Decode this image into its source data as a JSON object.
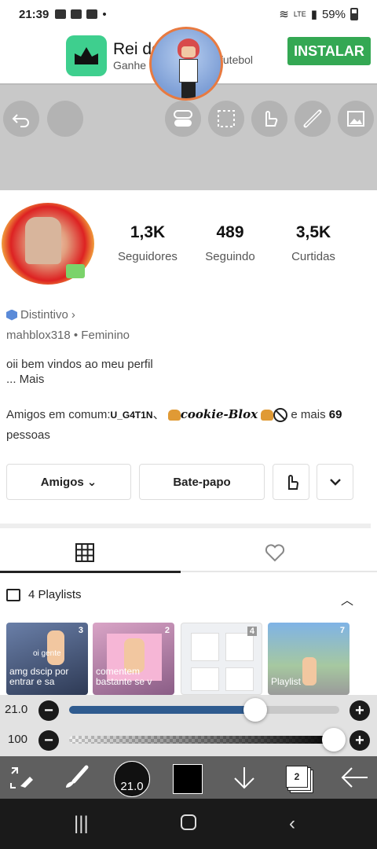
{
  "status_bar": {
    "time": "21:39",
    "network": "LTE",
    "battery": "59%"
  },
  "ad": {
    "title": "Rei do",
    "subtitle": "Ganhe",
    "subtitle_suffix": "futebol",
    "install_label": "INSTALAR"
  },
  "profile": {
    "stats": [
      {
        "value": "1,3K",
        "label": "Seguidores"
      },
      {
        "value": "489",
        "label": "Seguindo"
      },
      {
        "value": "3,5K",
        "label": "Curtidas"
      }
    ],
    "badge_label": "Distintivo",
    "handle": "mahblox318 • Feminino",
    "bio_line1": "oii bem vindos ao meu perfil",
    "bio_more": "... Mais",
    "mutual_prefix": "Amigos em comum:",
    "mutual_user1": "U_G4T1N",
    "mutual_user2": "cookie-Blox",
    "mutual_suffix": "e mais",
    "mutual_count": "69",
    "mutual_people": "pessoas",
    "friends_button": "Amigos",
    "chat_button": "Bate-papo"
  },
  "playlists": {
    "header": "4 Playlists",
    "items": [
      {
        "count": "3",
        "caption": "amg dscip por entrar e sa",
        "inner_label": "oi gente"
      },
      {
        "count": "2",
        "caption": "comentem bastante se v"
      },
      {
        "count": "4",
        "caption": ""
      },
      {
        "count": "7",
        "caption": "Playlist"
      }
    ]
  },
  "sliders": {
    "size_value": "21.0",
    "opacity_value": "100",
    "size_fraction": 0.69,
    "opacity_fraction": 1.0
  },
  "toolbar": {
    "brush_size": "21.0",
    "layer_count": "2"
  },
  "colors": {
    "accent_green": "#34a853",
    "slider_blue": "#2f5b8f",
    "toolbar_bg": "#5f5f5f"
  }
}
